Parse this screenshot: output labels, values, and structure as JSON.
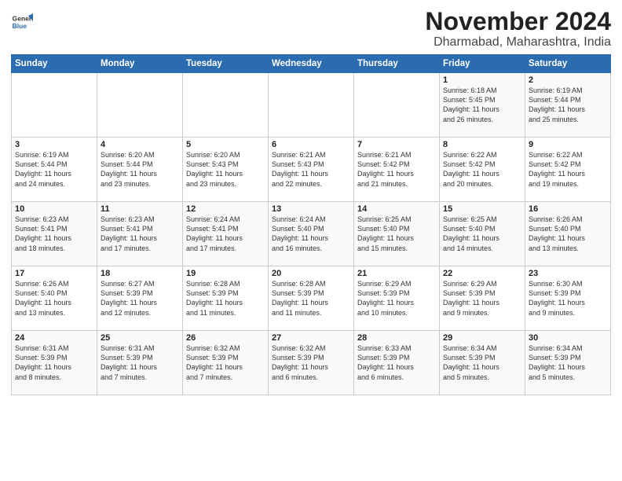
{
  "logo": {
    "line1": "General",
    "line2": "Blue"
  },
  "title": "November 2024",
  "subtitle": "Dharmabad, Maharashtra, India",
  "weekdays": [
    "Sunday",
    "Monday",
    "Tuesday",
    "Wednesday",
    "Thursday",
    "Friday",
    "Saturday"
  ],
  "weeks": [
    [
      {
        "day": "",
        "info": ""
      },
      {
        "day": "",
        "info": ""
      },
      {
        "day": "",
        "info": ""
      },
      {
        "day": "",
        "info": ""
      },
      {
        "day": "",
        "info": ""
      },
      {
        "day": "1",
        "info": "Sunrise: 6:18 AM\nSunset: 5:45 PM\nDaylight: 11 hours\nand 26 minutes."
      },
      {
        "day": "2",
        "info": "Sunrise: 6:19 AM\nSunset: 5:44 PM\nDaylight: 11 hours\nand 25 minutes."
      }
    ],
    [
      {
        "day": "3",
        "info": "Sunrise: 6:19 AM\nSunset: 5:44 PM\nDaylight: 11 hours\nand 24 minutes."
      },
      {
        "day": "4",
        "info": "Sunrise: 6:20 AM\nSunset: 5:44 PM\nDaylight: 11 hours\nand 23 minutes."
      },
      {
        "day": "5",
        "info": "Sunrise: 6:20 AM\nSunset: 5:43 PM\nDaylight: 11 hours\nand 23 minutes."
      },
      {
        "day": "6",
        "info": "Sunrise: 6:21 AM\nSunset: 5:43 PM\nDaylight: 11 hours\nand 22 minutes."
      },
      {
        "day": "7",
        "info": "Sunrise: 6:21 AM\nSunset: 5:42 PM\nDaylight: 11 hours\nand 21 minutes."
      },
      {
        "day": "8",
        "info": "Sunrise: 6:22 AM\nSunset: 5:42 PM\nDaylight: 11 hours\nand 20 minutes."
      },
      {
        "day": "9",
        "info": "Sunrise: 6:22 AM\nSunset: 5:42 PM\nDaylight: 11 hours\nand 19 minutes."
      }
    ],
    [
      {
        "day": "10",
        "info": "Sunrise: 6:23 AM\nSunset: 5:41 PM\nDaylight: 11 hours\nand 18 minutes."
      },
      {
        "day": "11",
        "info": "Sunrise: 6:23 AM\nSunset: 5:41 PM\nDaylight: 11 hours\nand 17 minutes."
      },
      {
        "day": "12",
        "info": "Sunrise: 6:24 AM\nSunset: 5:41 PM\nDaylight: 11 hours\nand 17 minutes."
      },
      {
        "day": "13",
        "info": "Sunrise: 6:24 AM\nSunset: 5:40 PM\nDaylight: 11 hours\nand 16 minutes."
      },
      {
        "day": "14",
        "info": "Sunrise: 6:25 AM\nSunset: 5:40 PM\nDaylight: 11 hours\nand 15 minutes."
      },
      {
        "day": "15",
        "info": "Sunrise: 6:25 AM\nSunset: 5:40 PM\nDaylight: 11 hours\nand 14 minutes."
      },
      {
        "day": "16",
        "info": "Sunrise: 6:26 AM\nSunset: 5:40 PM\nDaylight: 11 hours\nand 13 minutes."
      }
    ],
    [
      {
        "day": "17",
        "info": "Sunrise: 6:26 AM\nSunset: 5:40 PM\nDaylight: 11 hours\nand 13 minutes."
      },
      {
        "day": "18",
        "info": "Sunrise: 6:27 AM\nSunset: 5:39 PM\nDaylight: 11 hours\nand 12 minutes."
      },
      {
        "day": "19",
        "info": "Sunrise: 6:28 AM\nSunset: 5:39 PM\nDaylight: 11 hours\nand 11 minutes."
      },
      {
        "day": "20",
        "info": "Sunrise: 6:28 AM\nSunset: 5:39 PM\nDaylight: 11 hours\nand 11 minutes."
      },
      {
        "day": "21",
        "info": "Sunrise: 6:29 AM\nSunset: 5:39 PM\nDaylight: 11 hours\nand 10 minutes."
      },
      {
        "day": "22",
        "info": "Sunrise: 6:29 AM\nSunset: 5:39 PM\nDaylight: 11 hours\nand 9 minutes."
      },
      {
        "day": "23",
        "info": "Sunrise: 6:30 AM\nSunset: 5:39 PM\nDaylight: 11 hours\nand 9 minutes."
      }
    ],
    [
      {
        "day": "24",
        "info": "Sunrise: 6:31 AM\nSunset: 5:39 PM\nDaylight: 11 hours\nand 8 minutes."
      },
      {
        "day": "25",
        "info": "Sunrise: 6:31 AM\nSunset: 5:39 PM\nDaylight: 11 hours\nand 7 minutes."
      },
      {
        "day": "26",
        "info": "Sunrise: 6:32 AM\nSunset: 5:39 PM\nDaylight: 11 hours\nand 7 minutes."
      },
      {
        "day": "27",
        "info": "Sunrise: 6:32 AM\nSunset: 5:39 PM\nDaylight: 11 hours\nand 6 minutes."
      },
      {
        "day": "28",
        "info": "Sunrise: 6:33 AM\nSunset: 5:39 PM\nDaylight: 11 hours\nand 6 minutes."
      },
      {
        "day": "29",
        "info": "Sunrise: 6:34 AM\nSunset: 5:39 PM\nDaylight: 11 hours\nand 5 minutes."
      },
      {
        "day": "30",
        "info": "Sunrise: 6:34 AM\nSunset: 5:39 PM\nDaylight: 11 hours\nand 5 minutes."
      }
    ]
  ]
}
